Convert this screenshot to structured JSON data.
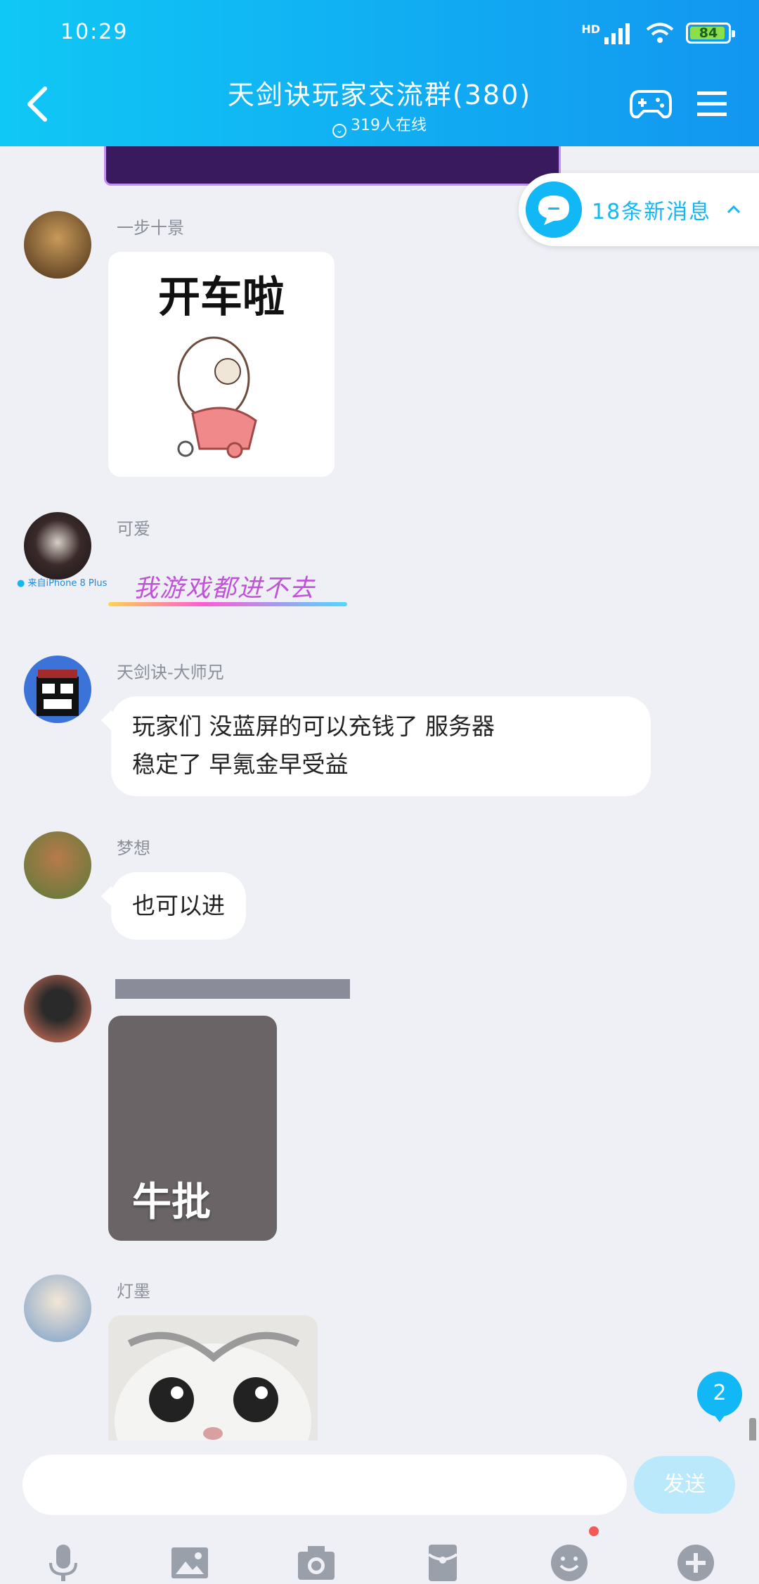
{
  "status_bar": {
    "time": "10:29",
    "network": "HD",
    "battery": "84"
  },
  "header": {
    "title": "天剑诀玩家交流群(380)",
    "subtitle": "319人在线"
  },
  "new_messages": {
    "label": "18条新消息"
  },
  "messages": [
    {
      "sender": "一步十景",
      "sticker_text": "开车啦"
    },
    {
      "sender": "可爱",
      "device": "来自iPhone 8 Plus",
      "text": "我游戏都进不去"
    },
    {
      "sender": "天剑诀-大师兄",
      "text_line1": "玩家们 没蓝屏的可以充钱了  服务器",
      "text_line2": "稳定了   早氪金早受益"
    },
    {
      "sender": "梦想",
      "text": "也可以进"
    },
    {
      "sender": "",
      "sticker_text": "牛批"
    },
    {
      "sender": "灯墨"
    }
  ],
  "unread_badge": "2",
  "input": {
    "placeholder": "",
    "send_label": "发送"
  },
  "colors": {
    "accent": "#12b7f5",
    "header_gradient": [
      "#10c8f5",
      "#1296f0"
    ],
    "background": "#eef0f5"
  },
  "toolbar_icons": [
    "microphone-icon",
    "image-icon",
    "camera-icon",
    "red-packet-icon",
    "emoji-icon",
    "plus-icon"
  ]
}
